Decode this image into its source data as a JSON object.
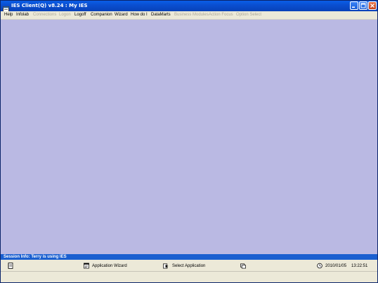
{
  "window": {
    "title": "IES Client(Q) v8.24 : My IES",
    "icons": {
      "app": "app-window-icon",
      "minimize": "minimize-icon",
      "maximize": "maximize-icon",
      "close": "close-icon"
    }
  },
  "menu": {
    "items": [
      {
        "label": "Help",
        "enabled": true
      },
      {
        "label": "Infolab",
        "enabled": true
      },
      {
        "label": "Connections",
        "enabled": false
      },
      {
        "label": "Logon",
        "enabled": false
      },
      {
        "label": "Logoff",
        "enabled": true
      },
      {
        "label": "Companion",
        "enabled": true
      },
      {
        "label": "Wizard",
        "enabled": true
      },
      {
        "label": "How do I",
        "enabled": true
      },
      {
        "label": "DataMarts",
        "enabled": true
      },
      {
        "label": "Business Modules",
        "enabled": false
      },
      {
        "label": "Action Focus",
        "enabled": false
      },
      {
        "label": "Option Select",
        "enabled": false
      }
    ]
  },
  "workspace": {
    "background": "#bab9e3"
  },
  "session": {
    "text": "Session Info: Terry is using IES"
  },
  "status": {
    "application_wizard": "Application Wizard",
    "select_application": "Select Application",
    "date": "2010/01/05",
    "time": "13:22:51",
    "icons": [
      "notebook-icon",
      "application-wizard-icon",
      "select-application-icon",
      "window-switch-icon",
      "clock-icon"
    ]
  },
  "colors": {
    "titlebar": "#0a4fd0",
    "session_bar": "#1a5fd0",
    "disabled_text": "#aca899"
  }
}
